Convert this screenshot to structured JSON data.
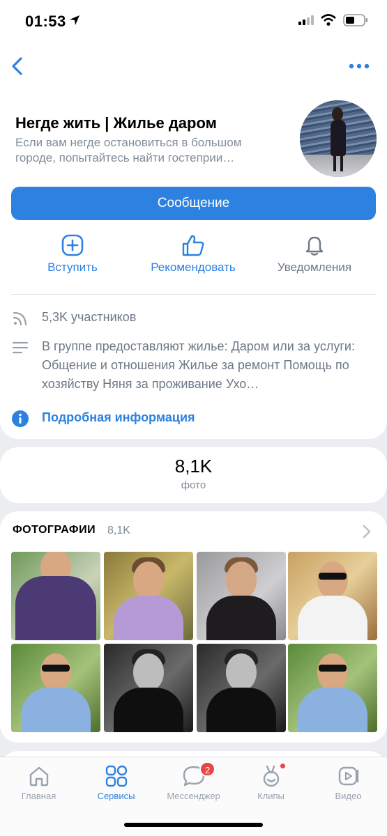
{
  "status_bar": {
    "time": "01:53"
  },
  "group": {
    "name": "Негде жить | Жилье даром",
    "description": "Если вам негде остановиться в большом городе, попытайтесь найти гостеприи…"
  },
  "actions": {
    "message": "Сообщение",
    "join": "Вступить",
    "recommend": "Рекомендовать",
    "notifications": "Уведомления"
  },
  "info": {
    "members": "5,3K участников",
    "description": "В группе предоставляют жилье:  Даром или за услуги: Общение и отношения Жилье за ремонт Помощь по хозяйству Няня за проживание  Ухо…",
    "more_info": "Подробная информация"
  },
  "stats": {
    "count": "8,1K",
    "label": "фото"
  },
  "photos": {
    "title": "ФОТОГРАФИИ",
    "count": "8,1K"
  },
  "tabbar": {
    "home": "Главная",
    "services": "Сервисы",
    "messenger": "Мессенджер",
    "messenger_badge": "2",
    "clips": "Клипы",
    "video": "Видео"
  },
  "colors": {
    "accent": "#2d81e0",
    "badge": "#e64646",
    "secondary_text": "#818c99"
  }
}
